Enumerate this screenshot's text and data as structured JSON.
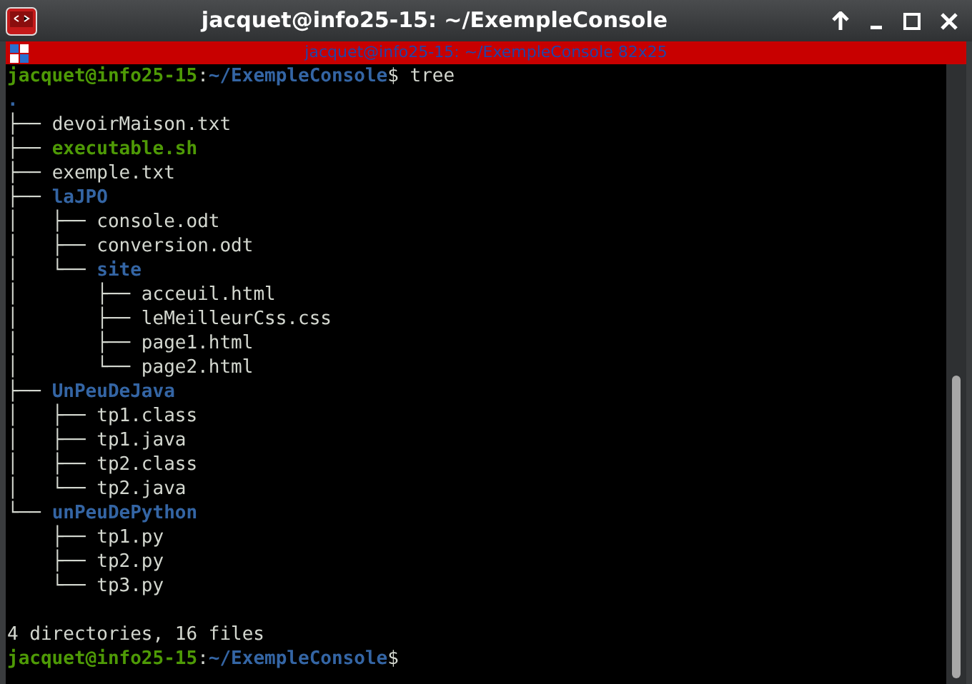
{
  "window": {
    "title": "jacquet@info25-15: ~/ExempleConsole"
  },
  "tab": {
    "title": "jacquet@info25-15: ~/ExempleConsole 82x25"
  },
  "terminal": {
    "command_prompt": {
      "user_host": "jacquet@info25-15",
      "separator": ":",
      "path": "~/ExempleConsole",
      "symbol": "$",
      "command": "tree"
    },
    "tree": {
      "root": ".",
      "children": [
        {
          "prefix": "├── ",
          "name": "devoirMaison.txt",
          "kind": "file"
        },
        {
          "prefix": "├── ",
          "name": "executable.sh",
          "kind": "executable"
        },
        {
          "prefix": "├── ",
          "name": "exemple.txt",
          "kind": "file"
        },
        {
          "prefix": "├── ",
          "name": "laJPO",
          "kind": "directory",
          "children": [
            {
              "prefix": "│   ├── ",
              "name": "console.odt",
              "kind": "file"
            },
            {
              "prefix": "│   ├── ",
              "name": "conversion.odt",
              "kind": "file"
            },
            {
              "prefix": "│   └── ",
              "name": "site",
              "kind": "directory",
              "children": [
                {
                  "prefix": "│       ├── ",
                  "name": "acceuil.html",
                  "kind": "file"
                },
                {
                  "prefix": "│       ├── ",
                  "name": "leMeilleurCss.css",
                  "kind": "file"
                },
                {
                  "prefix": "│       ├── ",
                  "name": "page1.html",
                  "kind": "file"
                },
                {
                  "prefix": "│       └── ",
                  "name": "page2.html",
                  "kind": "file"
                }
              ]
            }
          ]
        },
        {
          "prefix": "├── ",
          "name": "UnPeuDeJava",
          "kind": "directory",
          "children": [
            {
              "prefix": "│   ├── ",
              "name": "tp1.class",
              "kind": "file"
            },
            {
              "prefix": "│   ├── ",
              "name": "tp1.java",
              "kind": "file"
            },
            {
              "prefix": "│   ├── ",
              "name": "tp2.class",
              "kind": "file"
            },
            {
              "prefix": "│   └── ",
              "name": "tp2.java",
              "kind": "file"
            }
          ]
        },
        {
          "prefix": "└── ",
          "name": "unPeuDePython",
          "kind": "directory",
          "children": [
            {
              "prefix": "    ├── ",
              "name": "tp1.py",
              "kind": "file"
            },
            {
              "prefix": "    ├── ",
              "name": "tp2.py",
              "kind": "file"
            },
            {
              "prefix": "    └── ",
              "name": "tp3.py",
              "kind": "file"
            }
          ]
        }
      ]
    },
    "summary": "4 directories, 16 files",
    "final_prompt": {
      "user_host": "jacquet@info25-15",
      "separator": ":",
      "path": "~/ExempleConsole",
      "symbol": "$"
    }
  }
}
